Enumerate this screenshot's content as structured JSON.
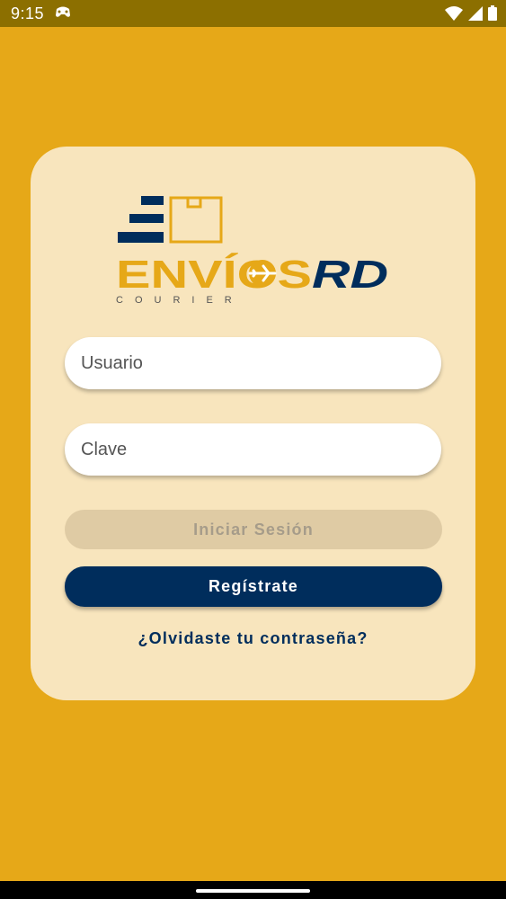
{
  "status_bar": {
    "time": "9:15",
    "notification_icon": "game-controller-icon",
    "icons": [
      "wifi-icon",
      "signal-icon",
      "battery-icon"
    ]
  },
  "logo": {
    "brand_main": "ENVÍOS",
    "brand_suffix": "RD",
    "tagline": "COURIER",
    "colors": {
      "gold": "#e6a818",
      "navy": "#002d5c"
    }
  },
  "form": {
    "username_placeholder": "Usuario",
    "password_placeholder": "Clave",
    "login_label": "Iniciar Sesión",
    "register_label": "Regístrate",
    "forgot_label": "¿Olvidaste tu contraseña?"
  },
  "theme": {
    "background": "#e6a818",
    "card": "#f8e5bd",
    "accent": "#002d5c"
  }
}
